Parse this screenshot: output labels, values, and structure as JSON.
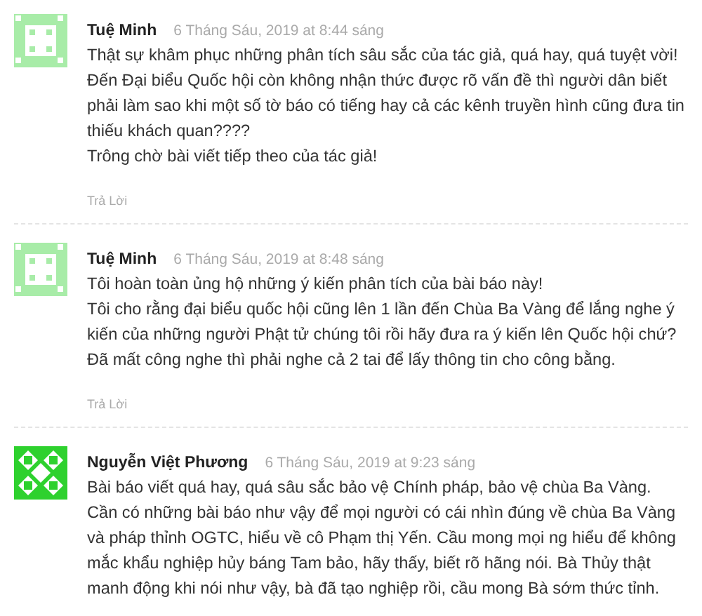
{
  "comments": [
    {
      "author": "Tuệ Minh",
      "date": "6 Tháng Sáu, 2019 at 8:44 sáng",
      "color": "#a8eca8",
      "paragraphs": [
        "Thật sự khâm phục những phân tích sâu sắc của tác giả, quá hay, quá tuyệt vời! Đến Đại biểu Quốc hội còn không nhận thức được rõ vấn đề thì người dân biết phải làm sao khi một số tờ báo có tiếng hay cả các kênh truyền hình cũng đưa tin thiếu khách quan????",
        "Trông chờ bài viết tiếp theo của tác giả!"
      ],
      "reply": "Trả Lời"
    },
    {
      "author": "Tuệ Minh",
      "date": "6 Tháng Sáu, 2019 at 8:48 sáng",
      "color": "#a8eca8",
      "paragraphs": [
        "Tôi hoàn toàn ủng hộ những ý kiến phân tích của bài báo này!",
        "Tôi cho rằng đại biểu quốc hội cũng lên 1 lần đến Chùa Ba Vàng để lắng nghe ý kiến của những người Phật tử chúng tôi rồi hãy đưa ra ý kiến lên Quốc hội chứ?",
        "Đã mất công nghe thì phải nghe cả 2 tai để lấy thông tin cho công bằng."
      ],
      "reply": "Trả Lời"
    },
    {
      "author": "Nguyễn Việt Phương",
      "date": "6 Tháng Sáu, 2019 at 9:23 sáng",
      "color": "#2ed12e",
      "paragraphs": [
        "Bài báo viết quá hay, quá sâu sắc bảo vệ Chính pháp, bảo vệ chùa Ba Vàng. Cần có những bài báo như vậy để mọi người có cái nhìn đúng về chùa Ba Vàng và pháp thỉnh OGTC, hiểu về cô Phạm thị Yến. Cầu mong mọi ng hiểu để không mắc khẩu nghiệp hủy báng Tam bảo, hãy thấy, biết rõ hãng nói. Bà Thủy thật manh động khi nói như vậy, bà đã tạo nghiệp rồi, cầu mong Bà sớm thức tỉnh."
      ]
    }
  ]
}
